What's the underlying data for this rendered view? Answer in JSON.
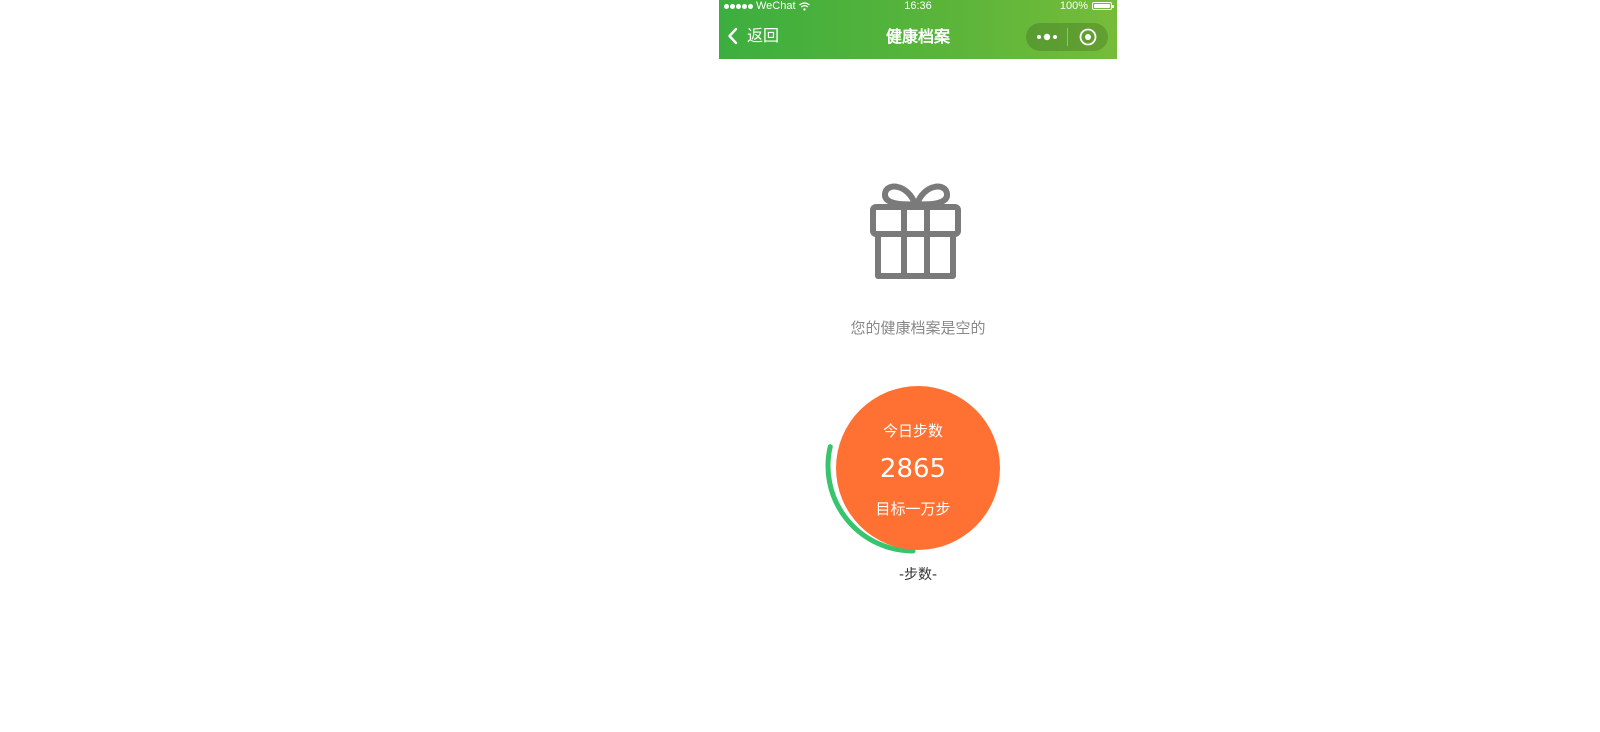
{
  "status_bar": {
    "carrier": "WeChat",
    "time": "16:36",
    "battery_percent": "100%"
  },
  "nav": {
    "back_label": "返回",
    "title": "健康档案"
  },
  "empty_state": {
    "icon": "gift-icon",
    "message": "您的健康档案是空的"
  },
  "steps": {
    "label": "今日步数",
    "count": "2865",
    "goal_label": "目标一万步",
    "caption": "-步数-",
    "progress": 0.2865
  },
  "colors": {
    "nav_green": "#4cb23c",
    "steps_orange": "#ff7132",
    "progress_green": "#38c46c",
    "muted_text": "#888888"
  }
}
